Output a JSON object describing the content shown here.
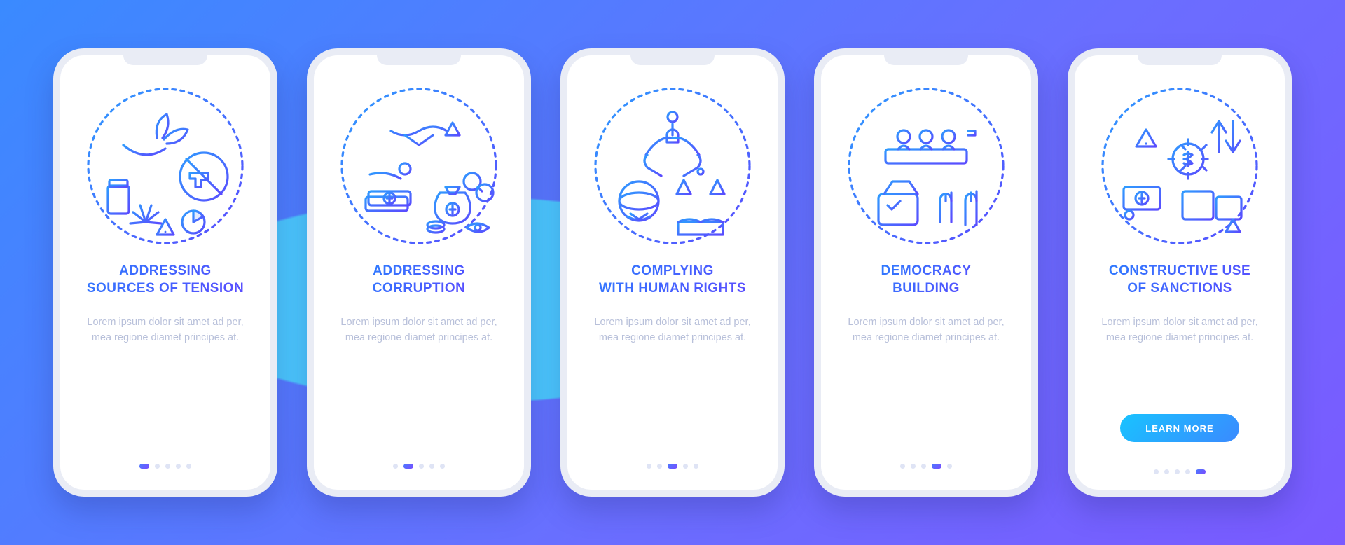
{
  "body_text": "Lorem ipsum dolor sit amet ad per, mea regione diamet principes at.",
  "button_label": "LEARN MORE",
  "total_screens": 5,
  "screens": [
    {
      "title": "ADDRESSING\nSOURCES OF TENSION",
      "icon": "tension-icon",
      "active_index": 0,
      "has_button": false
    },
    {
      "title": "ADDRESSING\nCORRUPTION",
      "icon": "corruption-icon",
      "active_index": 1,
      "has_button": false
    },
    {
      "title": "COMPLYING\nWITH HUMAN RIGHTS",
      "icon": "human-rights-icon",
      "active_index": 2,
      "has_button": false
    },
    {
      "title": "DEMOCRACY\nBUILDING",
      "icon": "democracy-icon",
      "active_index": 3,
      "has_button": false
    },
    {
      "title": "CONSTRUCTIVE USE\nOF SANCTIONS",
      "icon": "sanctions-icon",
      "active_index": 4,
      "has_button": true
    }
  ]
}
